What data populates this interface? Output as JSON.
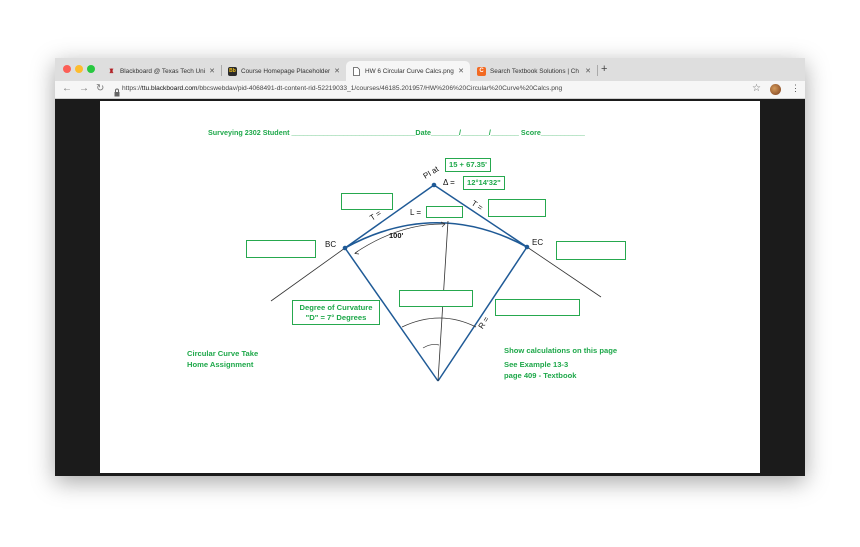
{
  "colors": {
    "accent_green": "#1ea84a",
    "curve_blue": "#1f5a96"
  },
  "browser": {
    "tabs": [
      {
        "title": "Blackboard @ Texas Tech Univ",
        "icon": "blackboard-icon"
      },
      {
        "title": "Course Homepage Placeholder",
        "icon": "bb-course-icon"
      },
      {
        "title": "HW 6 Circular Curve Calcs.png",
        "icon": "page-icon"
      },
      {
        "title": "Search Textbook Solutions | Ch",
        "icon": "chegg-icon"
      }
    ],
    "new_tab": "+",
    "url_prefix": "https://",
    "url_host": "ttu.blackboard.com",
    "url_path": "/bbcswebdav/pid-4068491-dt-content-rid-52219033_1/courses/46185.201957/HW%206%20Circular%20Curve%20Calcs.png"
  },
  "worksheet": {
    "header": "Surveying 2302  Student _______________________________Date_______/_______/_______ Score___________",
    "pi_label": "PI at",
    "pi_station": "15 + 67.35'",
    "delta_symbol": "Δ =",
    "delta_value": "12°14'32\"",
    "t_left": "T =",
    "t_right": "T =",
    "l_label": "L =",
    "bc_label": "BC",
    "ec_label": "EC",
    "hundred": "100'",
    "r_label": "R =",
    "doc_line1": "Degree of Curvature",
    "doc_line2": "\"D\" = 7° Degrees",
    "assign_line1": "Circular Curve Take",
    "assign_line2": "Home Assignment",
    "calc_line1": "Show calculations on this page",
    "calc_line2": "See Example 13-3",
    "calc_line3": "page 409 - Textbook"
  }
}
